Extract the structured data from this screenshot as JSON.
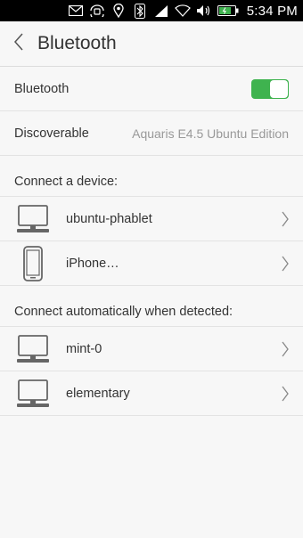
{
  "status_bar": {
    "time": "5:34 PM",
    "icons": [
      "mail-icon",
      "rotation-lock-icon",
      "location-icon",
      "bluetooth-icon",
      "signal-icon",
      "wifi-icon",
      "volume-icon",
      "battery-icon"
    ]
  },
  "header": {
    "title": "Bluetooth"
  },
  "settings": {
    "bluetooth_label": "Bluetooth",
    "bluetooth_enabled": true,
    "discoverable_label": "Discoverable",
    "discoverable_value": "Aquaris E4.5 Ubuntu Edition"
  },
  "connect_section": {
    "heading": "Connect a device:",
    "devices": [
      {
        "name": "ubuntu-phablet",
        "icon": "computer-icon"
      },
      {
        "name": "iPhone…",
        "icon": "phone-icon"
      }
    ]
  },
  "auto_section": {
    "heading": "Connect automatically when detected:",
    "devices": [
      {
        "name": "mint-0",
        "icon": "computer-icon"
      },
      {
        "name": "elementary",
        "icon": "computer-icon"
      }
    ]
  },
  "colors": {
    "toggle_on": "#3fb34f",
    "status_bar": "#000000",
    "background": "#f7f7f7"
  }
}
